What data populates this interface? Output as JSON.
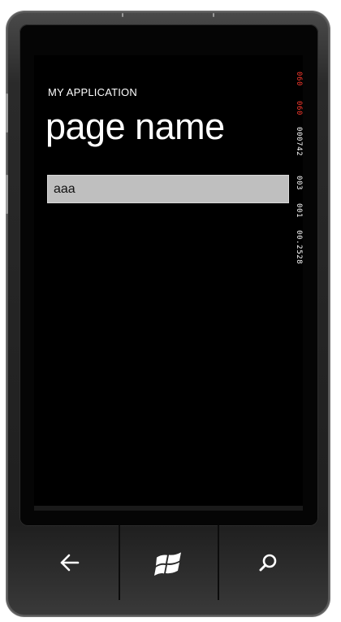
{
  "phone": {
    "nav_buttons": [
      {
        "name": "back",
        "icon": "back-arrow-icon"
      },
      {
        "name": "start",
        "icon": "windows-logo-icon"
      },
      {
        "name": "search",
        "icon": "search-icon"
      }
    ]
  },
  "app": {
    "title": "MY APPLICATION",
    "page_title": "page name"
  },
  "textbox": {
    "value": "aaa"
  },
  "frame_counters": [
    {
      "text": "060",
      "color": "#ff3b2f"
    },
    {
      "text": "060",
      "color": "#ff3b2f"
    },
    {
      "text": "000742",
      "color": "#ffffff"
    },
    {
      "text": "003",
      "color": "#ffffff"
    },
    {
      "text": "001",
      "color": "#ffffff"
    },
    {
      "text": "00.2528",
      "color": "#ffffff"
    }
  ],
  "colors": {
    "background": "#000000",
    "foreground": "#ffffff",
    "textbox_background": "#bfbfbf",
    "counter_accent": "#ff3b2f"
  }
}
